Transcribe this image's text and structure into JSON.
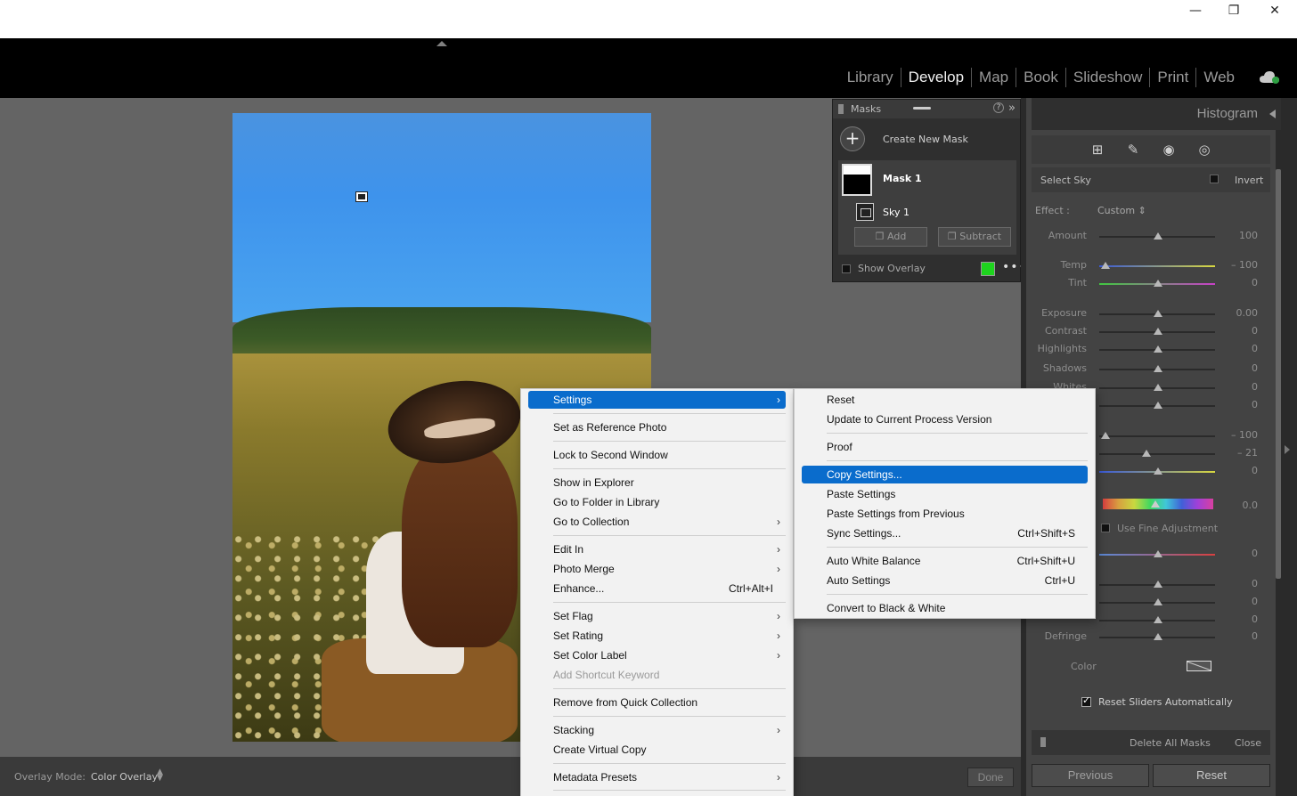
{
  "window": {
    "min_icon": "minimize-icon",
    "max_icon": "maximize-icon",
    "close_icon": "close-icon"
  },
  "modules": [
    "Library",
    "Develop",
    "Map",
    "Book",
    "Slideshow",
    "Print",
    "Web"
  ],
  "active_module": "Develop",
  "masks_panel": {
    "title": "Masks",
    "create_new": "Create New Mask",
    "mask_name": "Mask 1",
    "component_name": "Sky 1",
    "add_label": "Add",
    "subtract_label": "Subtract",
    "show_overlay": "Show Overlay",
    "overlay_color": "#1ed41e"
  },
  "right_panel": {
    "histogram": "Histogram",
    "select_label": "Select Sky",
    "invert_label": "Invert",
    "effect_label": "Effect :",
    "effect_value": "Custom",
    "sliders": [
      {
        "label": "Amount",
        "value": "100"
      },
      {
        "label": "Temp",
        "value": "– 100"
      },
      {
        "label": "Tint",
        "value": "0"
      },
      {
        "label": "Exposure",
        "value": "0.00"
      },
      {
        "label": "Contrast",
        "value": "0"
      },
      {
        "label": "Highlights",
        "value": "0"
      },
      {
        "label": "Shadows",
        "value": "0"
      },
      {
        "label": "Whites",
        "value": "0"
      },
      {
        "label": "",
        "value": "0"
      },
      {
        "label": "",
        "value": "– 100"
      },
      {
        "label": "",
        "value": "– 21"
      },
      {
        "label": "",
        "value": "0"
      }
    ],
    "hue_value": "0.0",
    "fine_adjustment": "Use Fine Adjustment",
    "lower_sliders": [
      {
        "label": "",
        "value": "0"
      },
      {
        "label": "",
        "value": "0"
      },
      {
        "label": "",
        "value": "0"
      },
      {
        "label": "",
        "value": "0"
      },
      {
        "label": "Defringe",
        "value": "0"
      }
    ],
    "color_label": "Color",
    "reset_auto": "Reset Sliders Automatically",
    "delete_all": "Delete All Masks",
    "close": "Close",
    "previous": "Previous",
    "reset": "Reset"
  },
  "bottom_bar": {
    "overlay_mode_label": "Overlay Mode:",
    "overlay_mode_value": "Color Overlay",
    "done": "Done"
  },
  "context_menu": {
    "items": [
      {
        "label": "Settings",
        "submenu": true,
        "highlighted": true
      },
      {
        "label": "Set as Reference Photo"
      },
      {
        "label": "Lock to Second Window"
      },
      {
        "label": "Show in Explorer"
      },
      {
        "label": "Go to Folder in Library"
      },
      {
        "label": "Go to Collection",
        "submenu": true
      },
      {
        "label": "Edit In",
        "submenu": true
      },
      {
        "label": "Photo Merge",
        "submenu": true
      },
      {
        "label": "Enhance...",
        "shortcut": "Ctrl+Alt+I"
      },
      {
        "label": "Set Flag",
        "submenu": true
      },
      {
        "label": "Set Rating",
        "submenu": true
      },
      {
        "label": "Set Color Label",
        "submenu": true
      },
      {
        "label": "Add Shortcut Keyword",
        "disabled": true
      },
      {
        "label": "Remove from Quick Collection"
      },
      {
        "label": "Stacking",
        "submenu": true
      },
      {
        "label": "Create Virtual Copy"
      },
      {
        "label": "Metadata Presets",
        "submenu": true
      }
    ]
  },
  "settings_submenu": {
    "items": [
      {
        "label": "Reset"
      },
      {
        "label": "Update to Current Process Version"
      },
      {
        "label": "Proof"
      },
      {
        "label": "Copy Settings...",
        "highlighted": true
      },
      {
        "label": "Paste Settings"
      },
      {
        "label": "Paste Settings from Previous"
      },
      {
        "label": "Sync Settings...",
        "shortcut": "Ctrl+Shift+S"
      },
      {
        "label": "Auto White Balance",
        "shortcut": "Ctrl+Shift+U"
      },
      {
        "label": "Auto Settings",
        "shortcut": "Ctrl+U"
      },
      {
        "label": "Convert to Black & White"
      }
    ]
  }
}
